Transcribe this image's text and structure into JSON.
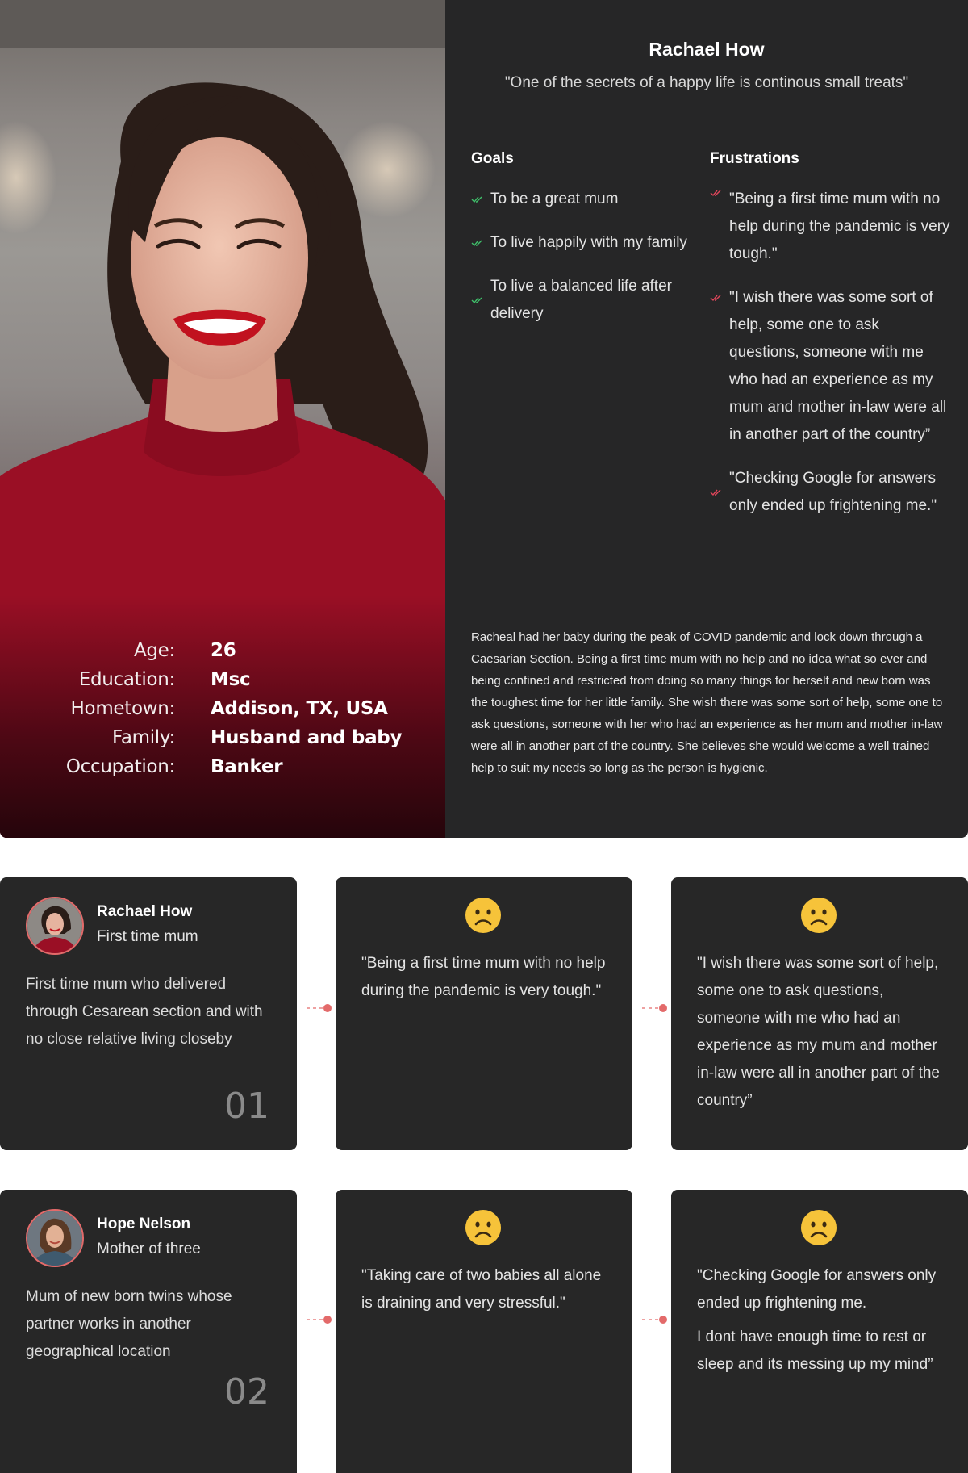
{
  "persona": {
    "name": "Rachael How",
    "quote": "\"One of the secrets of a happy life is continous small treats\"",
    "photo_alt": "portrait-photo",
    "facts": [
      {
        "label": "Age:",
        "value": "26"
      },
      {
        "label": "Education:",
        "value": "Msc"
      },
      {
        "label": "Hometown:",
        "value": "Addison, TX, USA"
      },
      {
        "label": "Family:",
        "value": "Husband and baby"
      },
      {
        "label": "Occupation:",
        "value": "Banker"
      }
    ],
    "goals": {
      "title": "Goals",
      "items": [
        "To be a great mum",
        "To live happily with my family",
        "To live a balanced life after delivery"
      ]
    },
    "frustrations": {
      "title": "Frustrations",
      "items": [
        "\"Being a first time mum with no help during the pandemic is very tough.\"",
        "\"I wish there was some sort of help, some one to ask questions, someone with me who had an experience as my mum and mother in-law were all in another part of the country”",
        "\"Checking Google for answers only ended up frightening me.\""
      ]
    },
    "story": "Racheal had her baby during the peak of COVID pandemic and lock down through a Caesarian Section. Being a first time mum with no help and no idea what so ever and being confined and restricted from doing so many things for herself and new born was the toughest time for her little family. She wish there was some sort of help, some one to ask questions, someone with her who had an experience as her mum and mother in-law were all in another part of the country. She believes she would welcome a well trained help to suit my needs so long as the person is hygienic."
  },
  "journeys": [
    {
      "user": {
        "name": "Rachael How",
        "role": "First time mum",
        "description": "First time mum who delivered through Cesarean section and with no close relative living closeby",
        "number": "01"
      },
      "pain_points": [
        {
          "emoji": "slightly-frowning-face",
          "text": [
            "\"Being a first time mum with no help during the pandemic is very tough.\""
          ]
        },
        {
          "emoji": "slightly-frowning-face",
          "text": [
            "\"I wish there was some sort of help, some one to ask questions, someone with me who had an experience as my mum and mother in-law were all in another part of the country”"
          ]
        }
      ]
    },
    {
      "user": {
        "name": "Hope Nelson",
        "role": "Mother of three",
        "description": "Mum of new born twins whose partner works in another geographical location",
        "number": "02"
      },
      "pain_points": [
        {
          "emoji": "slightly-frowning-face",
          "text": [
            "\"Taking care of two babies all alone is draining and very stressful.\""
          ]
        },
        {
          "emoji": "slightly-frowning-face",
          "text": [
            "\"Checking Google for answers only ended up frightening me.",
            "I dont have enough time to rest or sleep and its messing up my mind”"
          ]
        }
      ]
    }
  ],
  "colors": {
    "panel": "#262627",
    "card": "#272727",
    "goal_check": "#3fbf6a",
    "frustration_check": "#e0455a",
    "connector": "#e36a6a",
    "emoji_face": "#f6c33a"
  },
  "icons": {
    "goal_check": "double-check-icon",
    "frustration_check": "double-check-icon",
    "mood": "slightly-frowning-face-icon",
    "connector": "dashed-connector-dot-icon"
  }
}
